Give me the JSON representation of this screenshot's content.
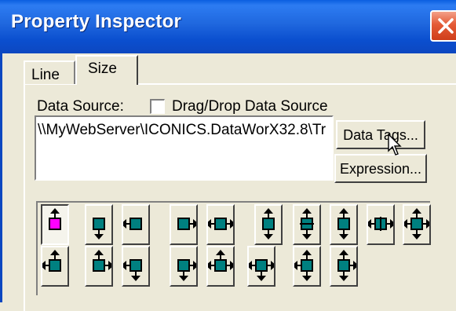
{
  "window": {
    "title": "Property Inspector"
  },
  "tabs": [
    {
      "label": "Line",
      "active": false
    },
    {
      "label": "Size",
      "active": true
    }
  ],
  "data_source": {
    "label": "Data Source:",
    "checkbox_label": "Drag/Drop Data Source",
    "checked": false,
    "value": "\\\\MyWebServer\\ICONICS.DataWorX32.8\\Tr"
  },
  "buttons": {
    "data_tags": "Data Tags...",
    "expression": "Expression..."
  },
  "size_modes": {
    "selected": "arrow-up",
    "row1": [
      "arrow-up",
      "arrow-down",
      "arrow-left",
      "arrow-right",
      "arrows-horizontal",
      "arrows-vertical",
      "arrows-vertical-center",
      "arrows-vertical-outer",
      "arrows-horizontal-center",
      "arrows-all"
    ],
    "row2": [
      "arrows-left-up",
      "arrows-right-up",
      "arrows-left-down",
      "arrows-right-down",
      "arrows-horizontal-up",
      "arrows-horizontal-down",
      "arrows-vertical-left",
      "arrows-vertical-right"
    ]
  },
  "colors": {
    "titlebar": "#0c47c0",
    "selected_fill": "#ff00ff",
    "icon_fill": "#008080"
  }
}
